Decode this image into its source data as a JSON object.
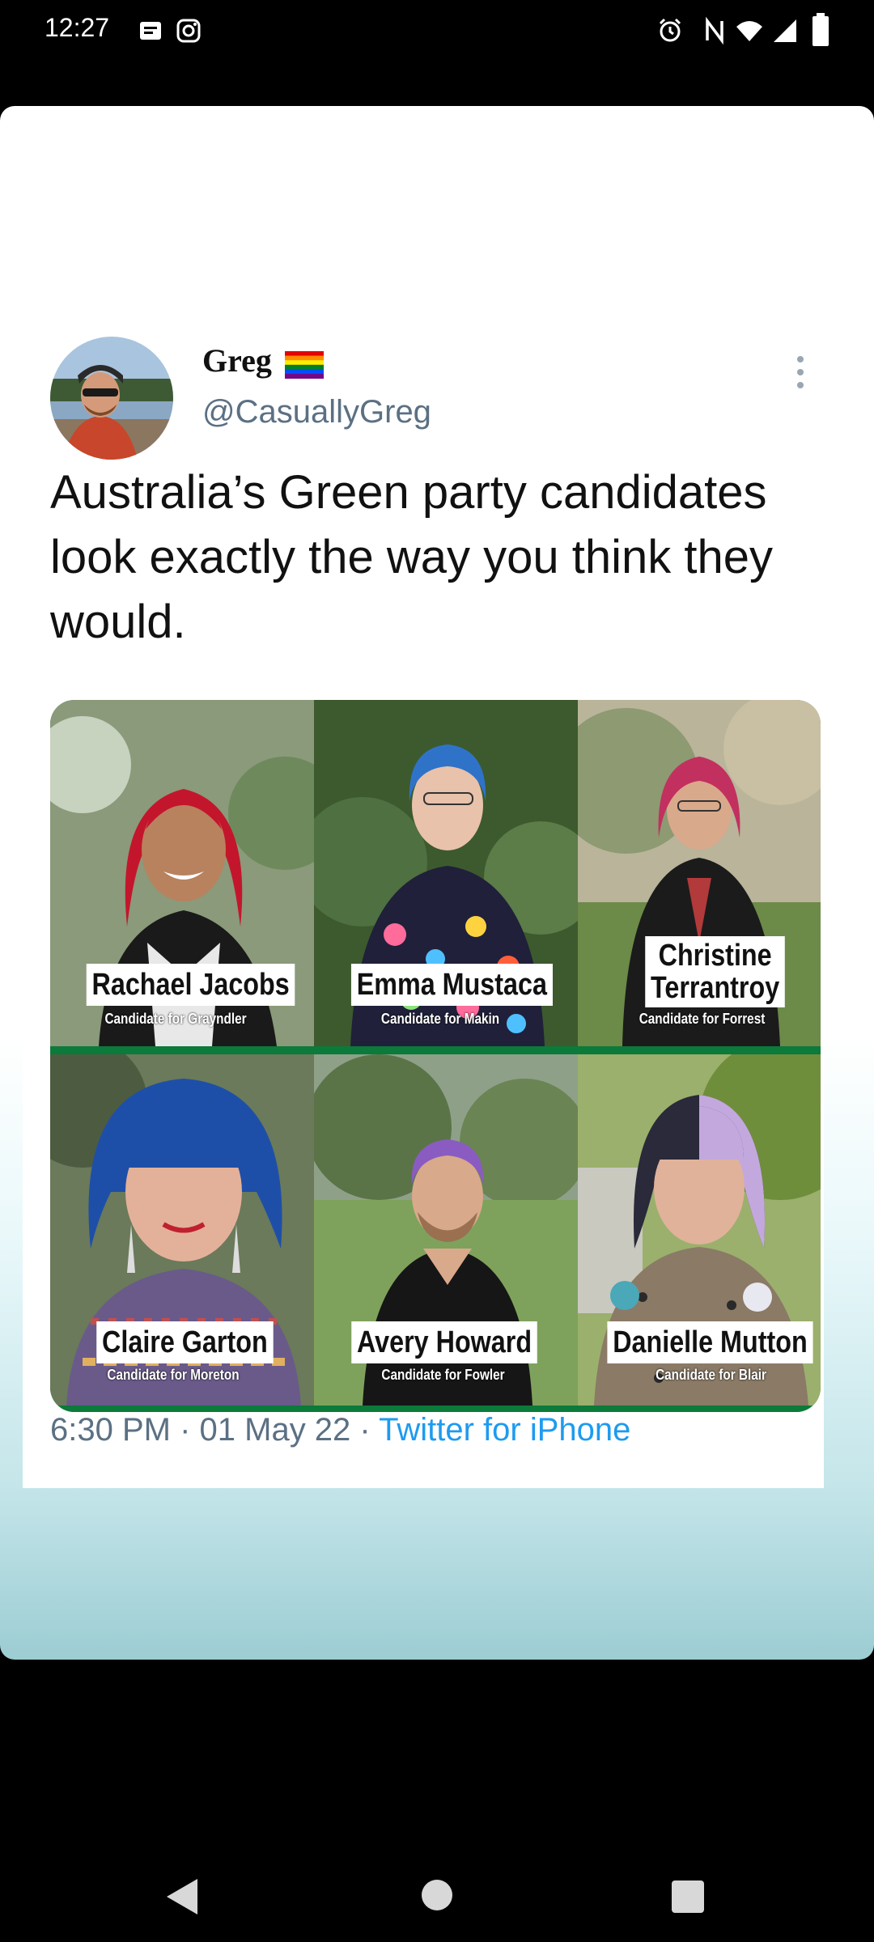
{
  "status_bar": {
    "time": "12:27",
    "left_icons": [
      "message-icon",
      "instagram-icon"
    ],
    "right_icons": [
      "alarm-icon",
      "nfc-icon",
      "wifi-icon",
      "signal-icon",
      "battery-icon"
    ]
  },
  "tweet": {
    "display_name": "Greg",
    "flag": "rainbow-flag-icon",
    "handle": "@CasuallyGreg",
    "text": "Australia’s Green party candidates look exactly the way you think they would.",
    "candidates": [
      {
        "name": "Rachael Jacobs",
        "subtitle": "Candidate for Grayndler",
        "hair": "#c3162c"
      },
      {
        "name": "Emma Mustaca",
        "subtitle": "Candidate for Makin",
        "hair": "#2f73c9"
      },
      {
        "name_line1": "Christine",
        "name_line2": "Terrantroy",
        "subtitle": "Candidate for Forrest",
        "hair": "#c2305f"
      },
      {
        "name": "Claire Garton",
        "subtitle": "Candidate for Moreton",
        "hair": "#1e4fa8"
      },
      {
        "name": "Avery Howard",
        "subtitle": "Candidate for Fowler",
        "hair": "#8a5cc2"
      },
      {
        "name": "Danielle Mutton",
        "subtitle": "Candidate for Blair",
        "hair": "#c3a8dd"
      }
    ],
    "time": "6:30 PM",
    "date": "01 May 22",
    "separator": " · ",
    "source": "Twitter for iPhone"
  },
  "colors": {
    "link": "#1d9bf0",
    "secondary_text": "#5b7083",
    "green_divider": "#0b7a3a"
  },
  "nav_bar": {
    "buttons": [
      "back-icon",
      "home-icon",
      "recents-icon"
    ]
  }
}
